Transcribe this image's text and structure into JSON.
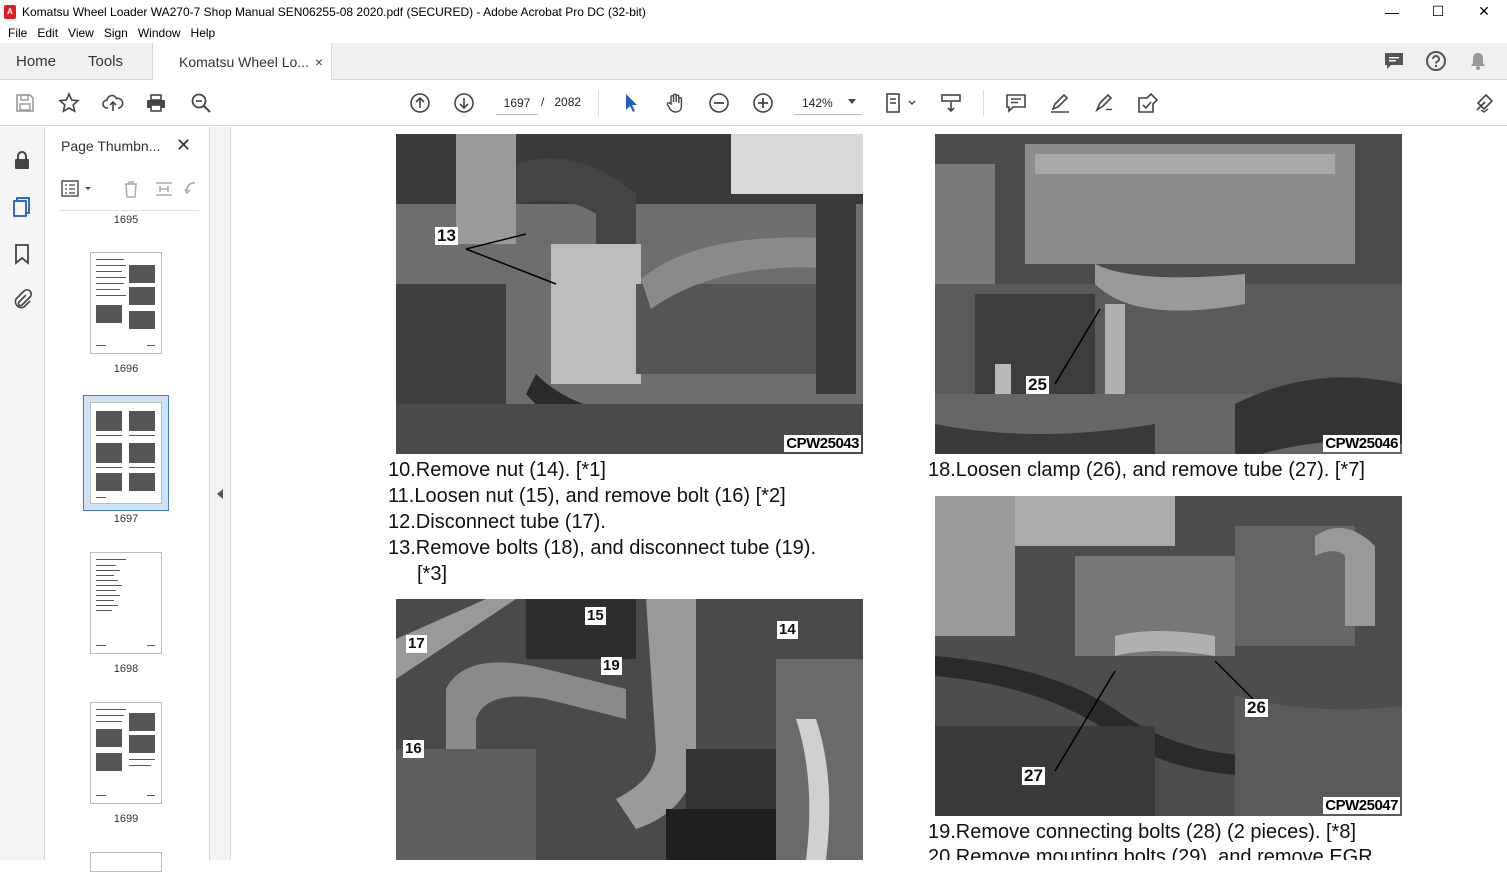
{
  "window": {
    "title": "Komatsu Wheel Loader WA270-7 Shop Manual SEN06255-08 2020.pdf (SECURED) - Adobe Acrobat Pro DC (32-bit)",
    "minimize": "—",
    "maximize": "☐",
    "close": "✕"
  },
  "menu": [
    "File",
    "Edit",
    "View",
    "Sign",
    "Window",
    "Help"
  ],
  "tabs": {
    "home": "Home",
    "tools": "Tools",
    "document": "Komatsu Wheel Lo...",
    "close": "×"
  },
  "toolbar": {
    "current_page": "1697",
    "page_sep": "/",
    "total_pages": "2082",
    "zoom": "142%"
  },
  "panel": {
    "title": "Page Thumbn...",
    "close": "✕",
    "thumbnails": [
      {
        "label": "1695"
      },
      {
        "label": "1696"
      },
      {
        "label": "1697",
        "selected": true
      },
      {
        "label": "1698"
      },
      {
        "label": "1699"
      }
    ]
  },
  "document": {
    "left_steps": [
      "10.Remove nut (14). [*1]",
      "11.Loosen nut (15), and remove bolt (16) [*2]",
      "12.Disconnect tube (17).",
      "13.Remove bolts (18), and disconnect tube (19).",
      "[*3]"
    ],
    "right_steps": [
      "18.Loosen clamp (26), and remove tube (27). [*7]",
      "19.Remove connecting bolts (28) (2 pieces). [*8]",
      "20.Remove mounting bolts (29), and remove EGR"
    ],
    "photos": {
      "p1": {
        "code": "CPW25043",
        "labels": [
          "13"
        ]
      },
      "p2": {
        "code": "CPW25046",
        "labels": [
          "25"
        ]
      },
      "p3": {
        "code": "",
        "labels": [
          "15",
          "14",
          "17",
          "19",
          "16"
        ]
      },
      "p4": {
        "code": "CPW25047",
        "labels": [
          "26",
          "27"
        ]
      }
    }
  },
  "colors": {
    "accent": "#3f7dcb",
    "acrobat_red": "#e02020"
  }
}
